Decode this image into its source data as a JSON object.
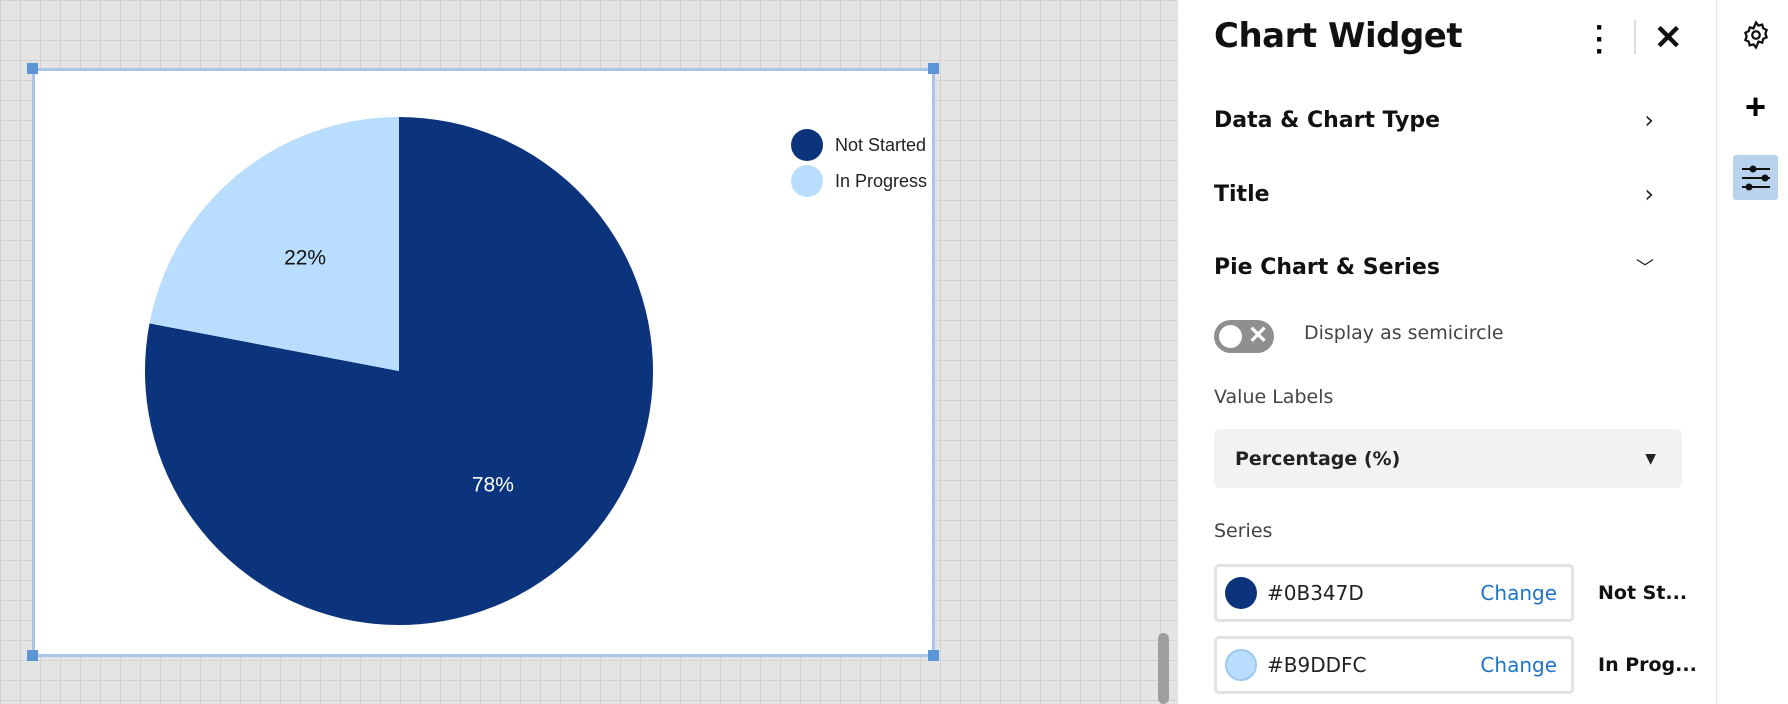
{
  "chart_data": {
    "type": "pie",
    "categories": [
      "Not Started",
      "In Progress"
    ],
    "values": [
      78,
      22
    ],
    "labels": [
      "78%",
      "22%"
    ],
    "colors": [
      "#0B347D",
      "#B9DDFC"
    ],
    "legend_placement": "top-right"
  },
  "panel": {
    "title": "Chart Widget",
    "sections": [
      {
        "label": "Data & Chart Type",
        "state": "collapsed"
      },
      {
        "label": "Title",
        "state": "collapsed"
      },
      {
        "label": "Pie Chart & Series",
        "state": "expanded"
      }
    ],
    "semicircle_label": "Display as semicircle",
    "semicircle_on": false,
    "value_labels_label": "Value Labels",
    "value_labels_selected": "Percentage (%)",
    "series_label": "Series",
    "series": [
      {
        "color": "#0B347D",
        "hex": "#0B347D",
        "change": "Change",
        "name": "Not St..."
      },
      {
        "color": "#B9DDFC",
        "hex": "#B9DDFC",
        "change": "Change",
        "name": "In Prog..."
      }
    ]
  },
  "rail": {
    "icons": [
      "gear-icon",
      "plus-icon",
      "sliders-icon"
    ],
    "active": "sliders-icon",
    "active_bg": "#B9D2EE"
  }
}
